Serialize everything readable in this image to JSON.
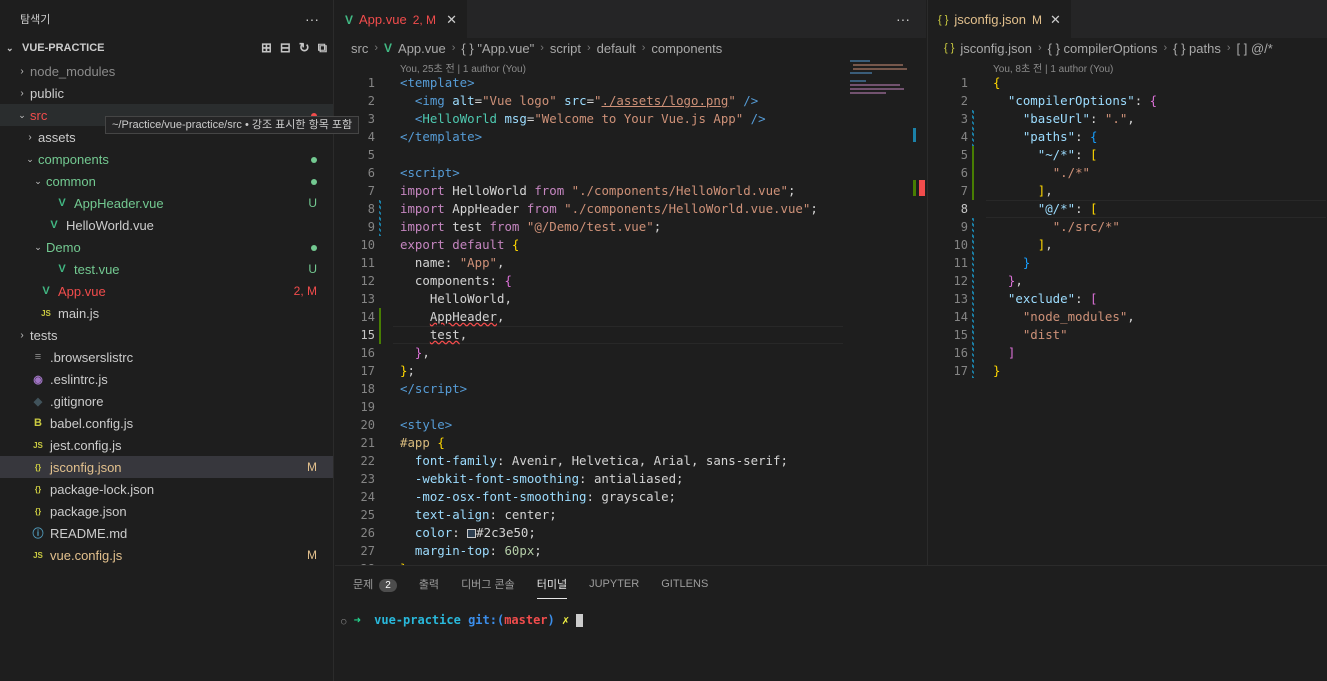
{
  "sidebar": {
    "title": "탐색기",
    "more": "···",
    "project": "VUE-PRACTICE",
    "tooltip": "~/Practice/vue-practice/src • 강조 표시한 항목 포함",
    "items": [
      {
        "label": "node_modules",
        "icon": "chevron-right",
        "color": "#8b8b8b",
        "status": ""
      },
      {
        "label": "public",
        "icon": "chevron-right",
        "color": "#cccccc",
        "status": ""
      },
      {
        "label": "src",
        "icon": "chevron-down",
        "color": "#f14c4c",
        "status": ""
      },
      {
        "label": "assets",
        "icon": "chevron-right",
        "color": "#cccccc",
        "status": ""
      },
      {
        "label": "components",
        "icon": "chevron-down",
        "color": "#73c991",
        "status": ""
      },
      {
        "label": "common",
        "icon": "chevron-down",
        "color": "#73c991",
        "status": ""
      },
      {
        "label": "AppHeader.vue",
        "icon": "vue-icon",
        "color": "#73c991",
        "status": "U"
      },
      {
        "label": "HelloWorld.vue",
        "icon": "vue-icon",
        "color": "#cccccc",
        "status": ""
      },
      {
        "label": "Demo",
        "icon": "chevron-down",
        "color": "#73c991",
        "status": ""
      },
      {
        "label": "test.vue",
        "icon": "vue-icon",
        "color": "#73c991",
        "status": "U"
      },
      {
        "label": "App.vue",
        "icon": "vue-icon",
        "color": "#f14c4c",
        "status": "2, M"
      },
      {
        "label": "main.js",
        "icon": "js-icon",
        "color": "#cccccc",
        "status": ""
      },
      {
        "label": "tests",
        "icon": "chevron-right",
        "color": "#cccccc",
        "status": ""
      },
      {
        "label": ".browserslistrc",
        "icon": "list-icon",
        "color": "#cccccc",
        "status": ""
      },
      {
        "label": ".eslintrc.js",
        "icon": "eslint-icon",
        "color": "#cccccc",
        "status": ""
      },
      {
        "label": ".gitignore",
        "icon": "git-icon",
        "color": "#cccccc",
        "status": ""
      },
      {
        "label": "babel.config.js",
        "icon": "babel-icon",
        "color": "#cccccc",
        "status": ""
      },
      {
        "label": "jest.config.js",
        "icon": "js-icon",
        "color": "#cccccc",
        "status": ""
      },
      {
        "label": "jsconfig.json",
        "icon": "json-icon",
        "color": "#e2c08d",
        "status": "M"
      },
      {
        "label": "package-lock.json",
        "icon": "json-icon",
        "color": "#cccccc",
        "status": ""
      },
      {
        "label": "package.json",
        "icon": "json-icon",
        "color": "#cccccc",
        "status": ""
      },
      {
        "label": "README.md",
        "icon": "info-icon",
        "color": "#cccccc",
        "status": ""
      },
      {
        "label": "vue.config.js",
        "icon": "js-icon",
        "color": "#e2c08d",
        "status": "M"
      }
    ]
  },
  "left_editor": {
    "tab_label": "App.vue",
    "tab_status": "2, M",
    "crumbs": [
      "src",
      "App.vue",
      "{ } \"App.vue\"",
      "script",
      "default",
      "components"
    ],
    "blame": "You, 25초 전 | 1 author (You)",
    "more": "···"
  },
  "right_editor": {
    "tab_label": "jsconfig.json",
    "tab_status": "M",
    "crumbs": [
      "jsconfig.json",
      "{ } compilerOptions",
      "{ } paths",
      "[ ] @/*"
    ],
    "blame": "You, 8초 전 | 1 author (You)"
  },
  "panel": {
    "tabs": [
      "문제",
      "출력",
      "디버그 콘솔",
      "터미널",
      "JUPYTER",
      "GITLENS"
    ],
    "problems_count": "2",
    "active_tab": "터미널",
    "prompt_dir": "vue-practice",
    "prompt_git": "git:(",
    "prompt_branch": "master",
    "prompt_close": ")",
    "prompt_mark": "✗"
  },
  "colors": {
    "accent": "#007acc",
    "modified": "#e2c08d",
    "untracked": "#73c991",
    "error": "#f14c4c"
  }
}
